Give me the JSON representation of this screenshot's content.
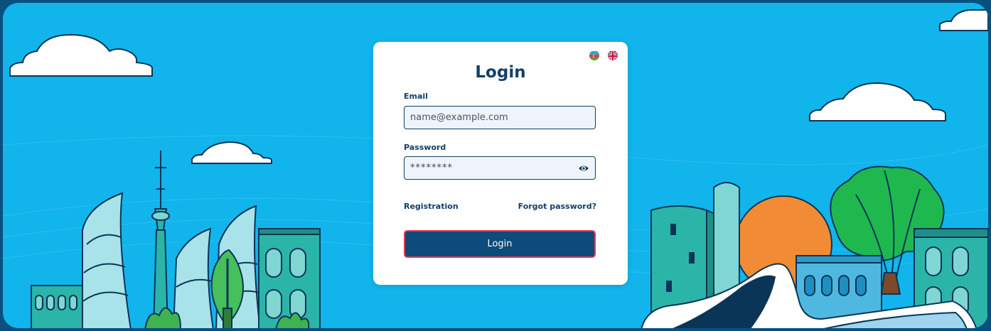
{
  "login": {
    "title": "Login",
    "email_label": "Email",
    "email_placeholder": "name@example.com",
    "password_label": "Password",
    "password_value": "********",
    "registration_link": "Registration",
    "forgot_link": "Forgot password?",
    "submit_label": "Login"
  },
  "languages": [
    {
      "code": "az",
      "icon": "azerbaijan-flag-icon"
    },
    {
      "code": "en",
      "icon": "uk-flag-icon"
    }
  ],
  "icons": {
    "password_toggle": "eye-icon"
  },
  "colors": {
    "sky": "#12b4ec",
    "frame": "#0b4f7e",
    "primary": "#0d4b7a",
    "button_border": "#e23a5a",
    "text": "#123f66"
  }
}
